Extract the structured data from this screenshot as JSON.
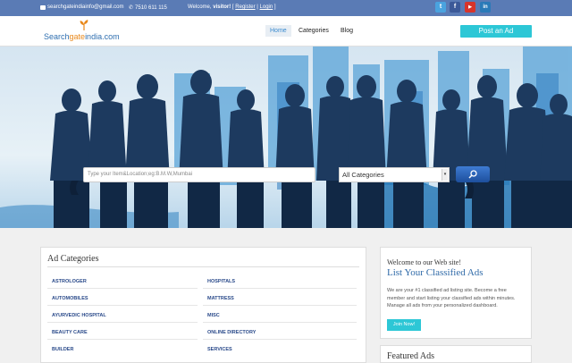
{
  "topbar": {
    "email": "searchgateindiainfo@gmail.com",
    "phone": "7510 611 115",
    "welcome_prefix": "Welcome,",
    "visitor": "visitor!",
    "sep1": " [ ",
    "register": "Register",
    "sep2": " | ",
    "login": "Login",
    "sep3": " ]",
    "social": [
      {
        "icon": "twitter-icon",
        "glyph": "t",
        "color": "#4aa3df"
      },
      {
        "icon": "facebook-icon",
        "glyph": "f",
        "color": "#3b5998"
      },
      {
        "icon": "youtube-icon",
        "glyph": "▶",
        "color": "#d8342b"
      },
      {
        "icon": "linkedin-icon",
        "glyph": "in",
        "color": "#2a7ab8"
      }
    ]
  },
  "header": {
    "logo_part1": "Search",
    "logo_part2": "gate",
    "logo_part3": "india.com",
    "nav": {
      "home": "Home",
      "categories": "Categories",
      "blog": "Blog"
    },
    "post_ad": "Post an Ad"
  },
  "search": {
    "placeholder": "Type your Item&Location;eg:B.M.W,Mumbai",
    "category": "All Categories"
  },
  "categories": {
    "title": "Ad Categories",
    "left": [
      "ASTROLOGER",
      "AUTOMOBILES",
      "AYURVEDIC HOSPITAL",
      "BEAUTY CARE",
      "BUILDER"
    ],
    "right": [
      "HOSPITALS",
      "MATTRESS",
      "MISC",
      "ONLINE DIRECTORY",
      "SERVICES"
    ]
  },
  "welcome": {
    "title": "Welcome to our Web site!",
    "heading": "List Your Classified Ads",
    "body": "We are your #1 classified ad listing site. Become a free member and start listing your classified ads within minutes. Manage all ads from your personalized dashboard.",
    "join": "Join Now!"
  },
  "featured": {
    "title": "Featured Ads"
  },
  "colors": {
    "topbar": "#5a7bb5",
    "accent": "#2dc7d6",
    "link": "#2a4a8a"
  }
}
